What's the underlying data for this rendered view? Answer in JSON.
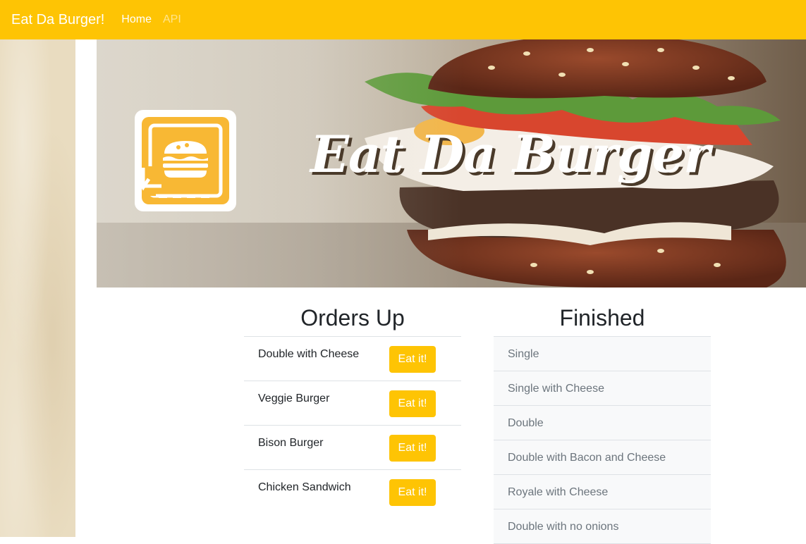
{
  "nav": {
    "brand": "Eat Da Burger!",
    "links": [
      "Home",
      "API"
    ]
  },
  "hero": {
    "title": "Eat Da Burger"
  },
  "orders": {
    "heading": "Orders Up",
    "items": [
      {
        "name": "Double with Cheese",
        "button": "Eat it!"
      },
      {
        "name": "Veggie Burger",
        "button": "Eat it!"
      },
      {
        "name": "Bison Burger",
        "button": "Eat it!"
      },
      {
        "name": "Chicken Sandwich",
        "button": "Eat it!"
      }
    ]
  },
  "finished": {
    "heading": "Finished",
    "items": [
      "Single",
      "Single with Cheese",
      "Double",
      "Double with Bacon and Cheese",
      "Royale with Cheese",
      "Double with no onions"
    ]
  },
  "colors": {
    "accent": "#fec404",
    "muted_text": "#6c757d"
  }
}
